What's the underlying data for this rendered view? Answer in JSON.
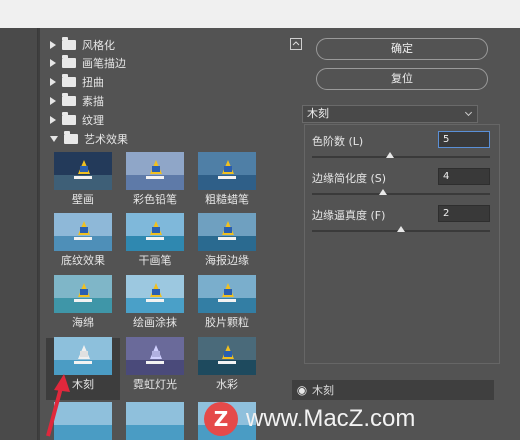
{
  "categories": [
    {
      "label": "风格化",
      "expanded": false
    },
    {
      "label": "画笔描边",
      "expanded": false
    },
    {
      "label": "扭曲",
      "expanded": false
    },
    {
      "label": "素描",
      "expanded": false
    },
    {
      "label": "纹理",
      "expanded": false
    },
    {
      "label": "艺术效果",
      "expanded": true
    }
  ],
  "filters": [
    {
      "label": "壁画"
    },
    {
      "label": "彩色铅笔"
    },
    {
      "label": "粗糙蜡笔"
    },
    {
      "label": "底纹效果"
    },
    {
      "label": "干画笔"
    },
    {
      "label": "海报边缘"
    },
    {
      "label": "海绵"
    },
    {
      "label": "绘画涂抹"
    },
    {
      "label": "胶片颗粒"
    },
    {
      "label": "木刻",
      "selected": true
    },
    {
      "label": "霓虹灯光"
    },
    {
      "label": "水彩"
    }
  ],
  "buttons": {
    "ok": "确定",
    "reset": "复位"
  },
  "filter_select": {
    "value": "木刻"
  },
  "params": [
    {
      "label": "色阶数 (L)",
      "value": "5",
      "slider": 0.44
    },
    {
      "label": "边缘简化度 (S)",
      "value": "4",
      "slider": 0.4
    },
    {
      "label": "边缘逼真度 (F)",
      "value": "2",
      "slider": 0.5
    }
  ],
  "layer": {
    "label": "木刻"
  },
  "watermark": {
    "logo": "Z",
    "text": "www.MacZ.com"
  },
  "colors": {
    "accent_focus": "#5a8fd6",
    "arrow": "#e0283c"
  }
}
